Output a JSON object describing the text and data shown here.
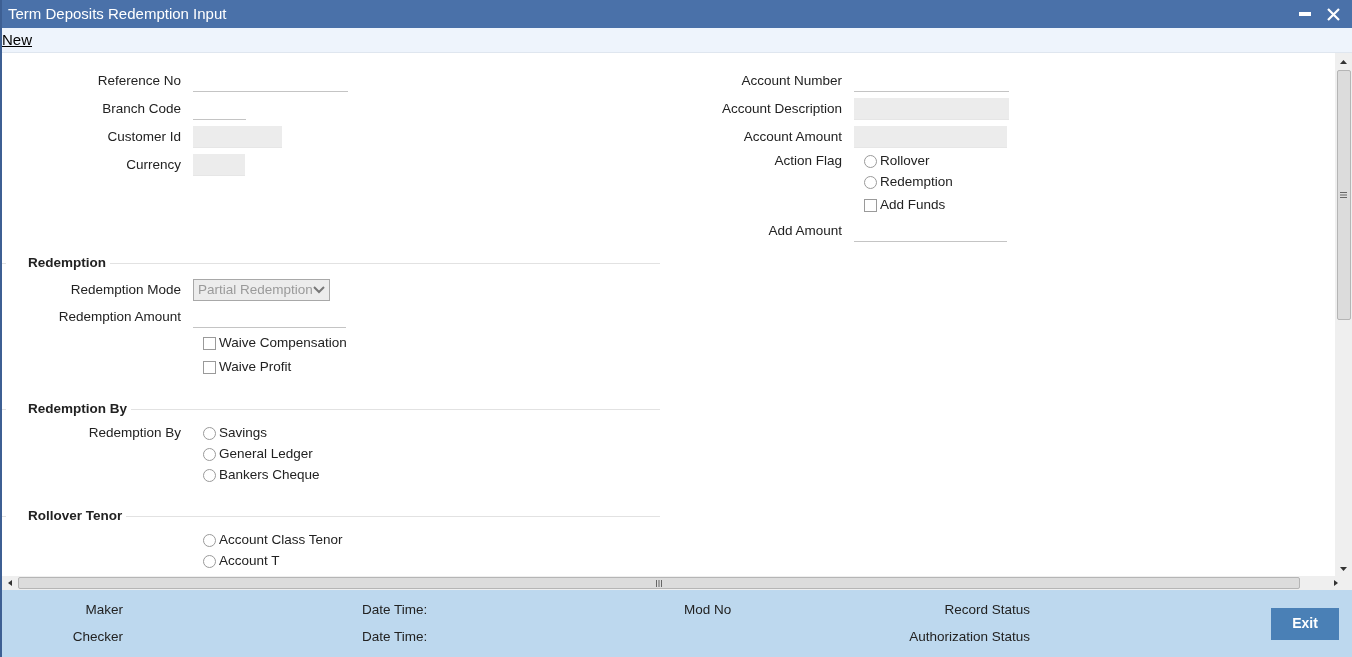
{
  "window": {
    "title": "Term Deposits Redemption Input"
  },
  "toolbar": [
    {
      "label": "New"
    }
  ],
  "left_fields": [
    {
      "label": "Reference No",
      "kind": "field",
      "disabled": false
    },
    {
      "label": "Branch Code",
      "kind": "field",
      "disabled": false
    },
    {
      "label": "Customer Id",
      "kind": "field",
      "disabled": true
    },
    {
      "label": "Currency",
      "kind": "field",
      "disabled": true
    }
  ],
  "right_fields": [
    {
      "label": "Account Number",
      "kind": "field",
      "disabled": false
    },
    {
      "label": "Account Description",
      "kind": "field",
      "disabled": true
    },
    {
      "label": "Account Amount",
      "kind": "field",
      "disabled": true
    },
    {
      "label": "Action Flag",
      "kind": "radio",
      "options": [
        {
          "label": "Rollover",
          "selected": false
        },
        {
          "label": "Redemption",
          "selected": false
        }
      ]
    },
    {
      "kind": "checkbox",
      "label": "Add Funds",
      "checked": false
    },
    {
      "label": "Add Amount",
      "kind": "field",
      "disabled": false
    }
  ],
  "sections": [
    {
      "title": "Redemption",
      "rows": [
        {
          "label": "Redemption Mode",
          "kind": "select",
          "value": "Partial Redemption",
          "disabled": true
        },
        {
          "label": "Redemption Amount",
          "kind": "field",
          "disabled": false
        },
        {
          "kind": "checkbox",
          "label": "Waive Compensation",
          "checked": false
        },
        {
          "kind": "checkbox",
          "label": "Waive Profit",
          "checked": false
        }
      ]
    },
    {
      "title": "Redemption By",
      "rows": [
        {
          "label": "Redemption By",
          "kind": "radio",
          "options": [
            {
              "label": "Savings",
              "selected": false
            },
            {
              "label": "General Ledger",
              "selected": false
            },
            {
              "label": "Bankers Cheque",
              "selected": false
            }
          ]
        }
      ]
    },
    {
      "title": "Rollover Tenor",
      "rows": [
        {
          "kind": "radio",
          "options": [
            {
              "label": "Account Class Tenor",
              "selected": false
            },
            {
              "label": "Account T",
              "selected": false
            }
          ]
        }
      ]
    }
  ],
  "audit": [
    {
      "role_label": "Maker",
      "date_label": "Date Time:",
      "number_label": "Mod No",
      "status_label": "Record Status"
    },
    {
      "role_label": "Checker",
      "date_label": "Date Time:",
      "status_label": "Authorization Status"
    }
  ],
  "buttons": [
    {
      "label": "Exit"
    }
  ]
}
